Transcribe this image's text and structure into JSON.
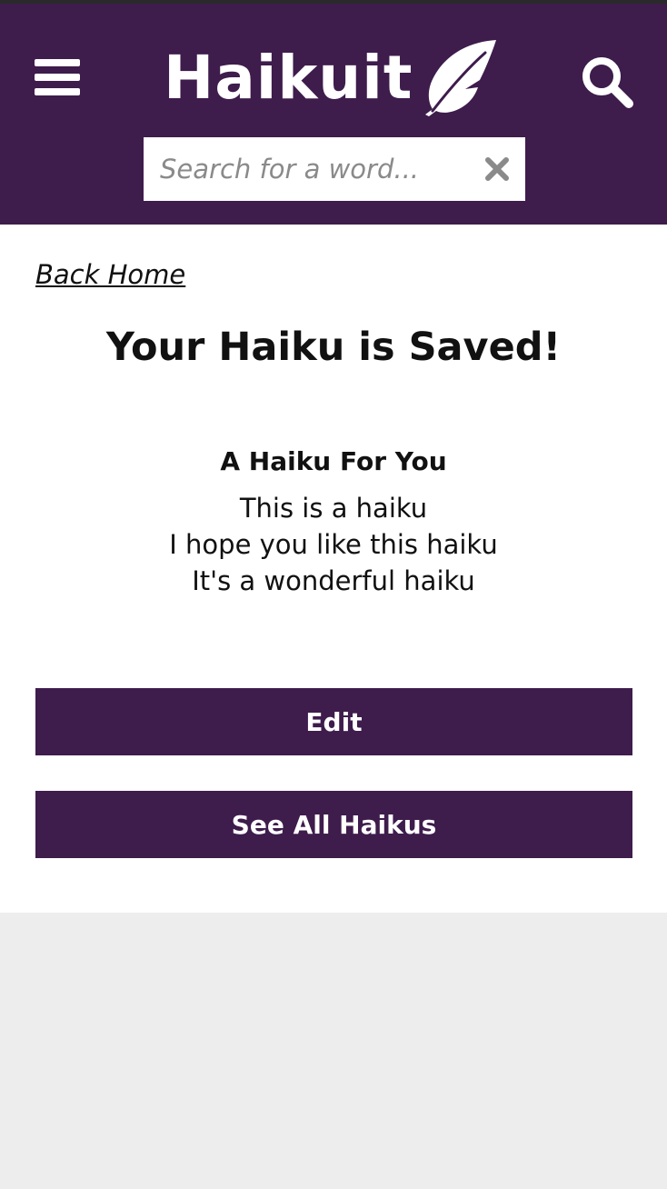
{
  "colors": {
    "brand": "#3e1c4c",
    "background": "#ededed",
    "surface": "#ffffff"
  },
  "header": {
    "logo_text": "Haikuit",
    "logo_icon": "feather-icon",
    "menu_icon": "hamburger-menu-icon",
    "search_icon": "search-icon",
    "search": {
      "placeholder": "Search for a word...",
      "value": "",
      "clear_icon": "close-icon"
    }
  },
  "main": {
    "back_link": "Back Home",
    "title": "Your Haiku is Saved!",
    "haiku": {
      "title": "A Haiku For You",
      "lines": [
        "This is a haiku",
        "I hope you like this haiku",
        "It's a wonderful haiku"
      ]
    },
    "buttons": {
      "edit": "Edit",
      "see_all": "See All Haikus"
    }
  }
}
